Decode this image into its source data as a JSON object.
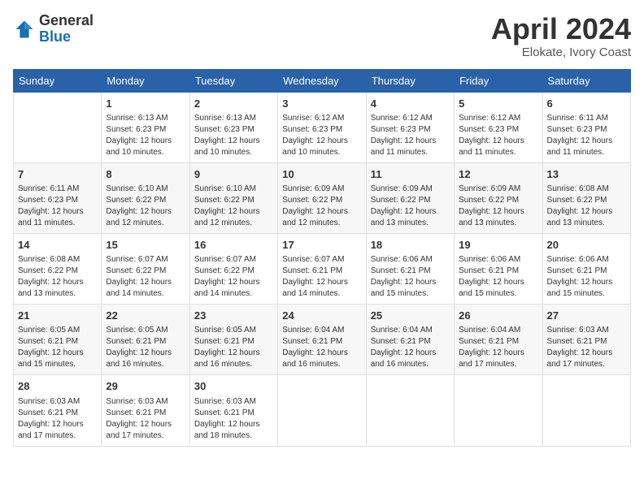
{
  "header": {
    "logo_general": "General",
    "logo_blue": "Blue",
    "month_title": "April 2024",
    "location": "Elokate, Ivory Coast"
  },
  "days_of_week": [
    "Sunday",
    "Monday",
    "Tuesday",
    "Wednesday",
    "Thursday",
    "Friday",
    "Saturday"
  ],
  "weeks": [
    [
      {
        "day": "",
        "info": ""
      },
      {
        "day": "1",
        "info": "Sunrise: 6:13 AM\nSunset: 6:23 PM\nDaylight: 12 hours\nand 10 minutes."
      },
      {
        "day": "2",
        "info": "Sunrise: 6:13 AM\nSunset: 6:23 PM\nDaylight: 12 hours\nand 10 minutes."
      },
      {
        "day": "3",
        "info": "Sunrise: 6:12 AM\nSunset: 6:23 PM\nDaylight: 12 hours\nand 10 minutes."
      },
      {
        "day": "4",
        "info": "Sunrise: 6:12 AM\nSunset: 6:23 PM\nDaylight: 12 hours\nand 11 minutes."
      },
      {
        "day": "5",
        "info": "Sunrise: 6:12 AM\nSunset: 6:23 PM\nDaylight: 12 hours\nand 11 minutes."
      },
      {
        "day": "6",
        "info": "Sunrise: 6:11 AM\nSunset: 6:23 PM\nDaylight: 12 hours\nand 11 minutes."
      }
    ],
    [
      {
        "day": "7",
        "info": "Sunrise: 6:11 AM\nSunset: 6:23 PM\nDaylight: 12 hours\nand 11 minutes."
      },
      {
        "day": "8",
        "info": "Sunrise: 6:10 AM\nSunset: 6:22 PM\nDaylight: 12 hours\nand 12 minutes."
      },
      {
        "day": "9",
        "info": "Sunrise: 6:10 AM\nSunset: 6:22 PM\nDaylight: 12 hours\nand 12 minutes."
      },
      {
        "day": "10",
        "info": "Sunrise: 6:09 AM\nSunset: 6:22 PM\nDaylight: 12 hours\nand 12 minutes."
      },
      {
        "day": "11",
        "info": "Sunrise: 6:09 AM\nSunset: 6:22 PM\nDaylight: 12 hours\nand 13 minutes."
      },
      {
        "day": "12",
        "info": "Sunrise: 6:09 AM\nSunset: 6:22 PM\nDaylight: 12 hours\nand 13 minutes."
      },
      {
        "day": "13",
        "info": "Sunrise: 6:08 AM\nSunset: 6:22 PM\nDaylight: 12 hours\nand 13 minutes."
      }
    ],
    [
      {
        "day": "14",
        "info": "Sunrise: 6:08 AM\nSunset: 6:22 PM\nDaylight: 12 hours\nand 13 minutes."
      },
      {
        "day": "15",
        "info": "Sunrise: 6:07 AM\nSunset: 6:22 PM\nDaylight: 12 hours\nand 14 minutes."
      },
      {
        "day": "16",
        "info": "Sunrise: 6:07 AM\nSunset: 6:22 PM\nDaylight: 12 hours\nand 14 minutes."
      },
      {
        "day": "17",
        "info": "Sunrise: 6:07 AM\nSunset: 6:21 PM\nDaylight: 12 hours\nand 14 minutes."
      },
      {
        "day": "18",
        "info": "Sunrise: 6:06 AM\nSunset: 6:21 PM\nDaylight: 12 hours\nand 15 minutes."
      },
      {
        "day": "19",
        "info": "Sunrise: 6:06 AM\nSunset: 6:21 PM\nDaylight: 12 hours\nand 15 minutes."
      },
      {
        "day": "20",
        "info": "Sunrise: 6:06 AM\nSunset: 6:21 PM\nDaylight: 12 hours\nand 15 minutes."
      }
    ],
    [
      {
        "day": "21",
        "info": "Sunrise: 6:05 AM\nSunset: 6:21 PM\nDaylight: 12 hours\nand 15 minutes."
      },
      {
        "day": "22",
        "info": "Sunrise: 6:05 AM\nSunset: 6:21 PM\nDaylight: 12 hours\nand 16 minutes."
      },
      {
        "day": "23",
        "info": "Sunrise: 6:05 AM\nSunset: 6:21 PM\nDaylight: 12 hours\nand 16 minutes."
      },
      {
        "day": "24",
        "info": "Sunrise: 6:04 AM\nSunset: 6:21 PM\nDaylight: 12 hours\nand 16 minutes."
      },
      {
        "day": "25",
        "info": "Sunrise: 6:04 AM\nSunset: 6:21 PM\nDaylight: 12 hours\nand 16 minutes."
      },
      {
        "day": "26",
        "info": "Sunrise: 6:04 AM\nSunset: 6:21 PM\nDaylight: 12 hours\nand 17 minutes."
      },
      {
        "day": "27",
        "info": "Sunrise: 6:03 AM\nSunset: 6:21 PM\nDaylight: 12 hours\nand 17 minutes."
      }
    ],
    [
      {
        "day": "28",
        "info": "Sunrise: 6:03 AM\nSunset: 6:21 PM\nDaylight: 12 hours\nand 17 minutes."
      },
      {
        "day": "29",
        "info": "Sunrise: 6:03 AM\nSunset: 6:21 PM\nDaylight: 12 hours\nand 17 minutes."
      },
      {
        "day": "30",
        "info": "Sunrise: 6:03 AM\nSunset: 6:21 PM\nDaylight: 12 hours\nand 18 minutes."
      },
      {
        "day": "",
        "info": ""
      },
      {
        "day": "",
        "info": ""
      },
      {
        "day": "",
        "info": ""
      },
      {
        "day": "",
        "info": ""
      }
    ]
  ]
}
